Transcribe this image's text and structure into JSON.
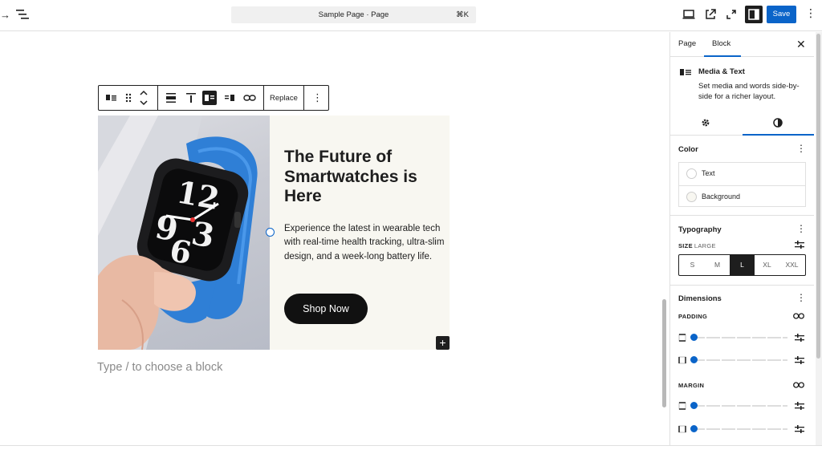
{
  "header": {
    "document_title": "Sample Page · Page",
    "shortcut": "⌘K",
    "save_label": "Save",
    "colors": {
      "save": "#0a64c9",
      "toolbar_active": "#1e1e1e"
    }
  },
  "block_toolbar": {
    "replace_label": "Replace"
  },
  "block": {
    "title": "The Future of Smartwatches is Here",
    "description": "Experience the latest in wearable tech with real-time health tracking, ultra-slim design, and a week-long battery life.",
    "button_label": "Shop Now",
    "image_alt": "Hand holding a smartwatch with a blue band",
    "text_bg": "#f8f7f1"
  },
  "canvas": {
    "placeholder": "Type / to choose a block"
  },
  "sidebar": {
    "tabs": [
      "Page",
      "Block"
    ],
    "active_tab": "Block",
    "block_card": {
      "title": "Media & Text",
      "description": "Set media and words side-by-side for a richer layout."
    },
    "subtabs": [
      "settings",
      "styles"
    ],
    "color": {
      "title": "Color",
      "items": [
        "Text",
        "Background"
      ]
    },
    "typography": {
      "title": "Typography",
      "size_label": "SIZE",
      "size_value": "LARGE",
      "options": [
        "S",
        "M",
        "L",
        "XL",
        "XXL"
      ],
      "selected": "L"
    },
    "dimensions": {
      "title": "Dimensions",
      "padding_label": "PADDING",
      "margin_label": "MARGIN"
    }
  }
}
